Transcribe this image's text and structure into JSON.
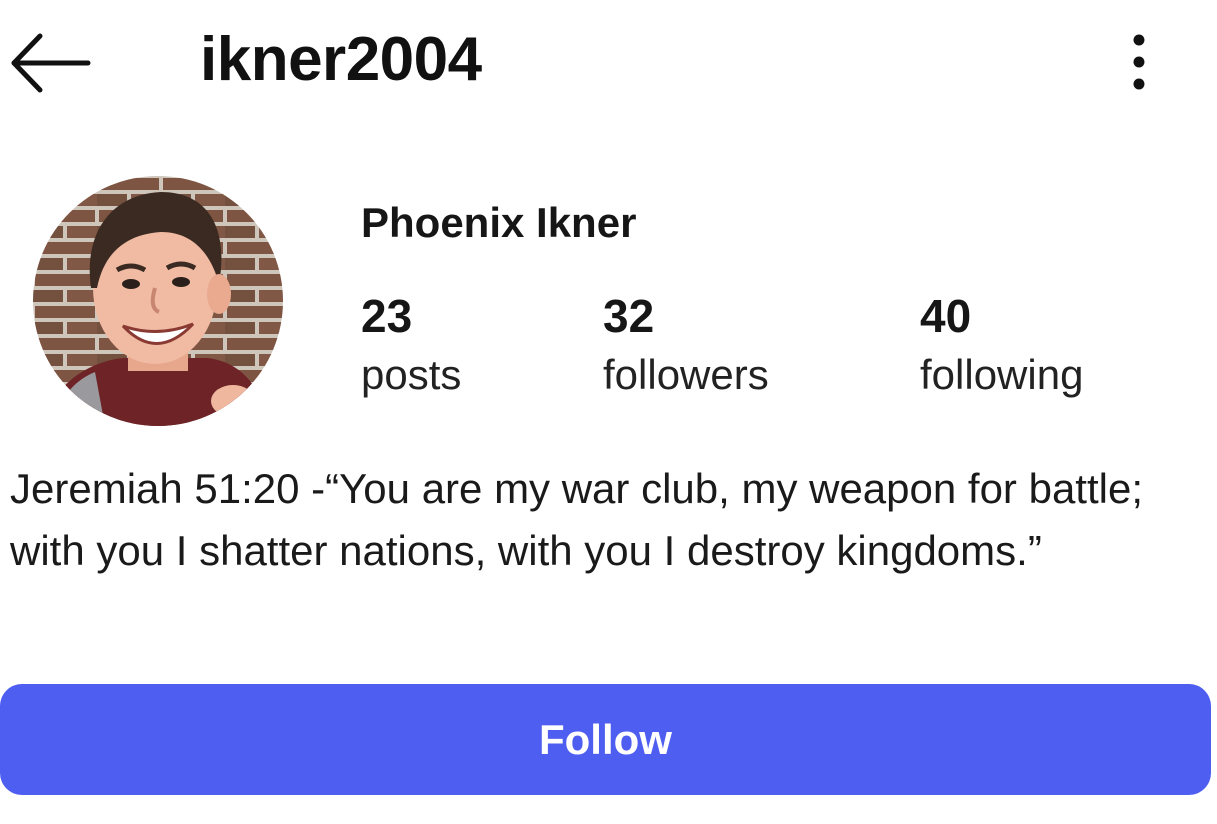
{
  "header": {
    "username": "ikner2004",
    "back_icon": "back-arrow-icon",
    "more_icon": "more-vertical-icon"
  },
  "profile": {
    "display_name": "Phoenix Ikner",
    "avatar": "profile-photo",
    "stats": [
      {
        "value": "23",
        "label": "posts"
      },
      {
        "value": "32",
        "label": "followers"
      },
      {
        "value": "40",
        "label": "following"
      }
    ],
    "bio": "Jeremiah 51:20 -“You are my war club, my weapon for battle; with you I shatter nations, with you I destroy kingdoms.”"
  },
  "actions": {
    "follow_label": "Follow"
  },
  "colors": {
    "accent": "#4e5ef1",
    "text": "#111111",
    "background": "#ffffff"
  }
}
